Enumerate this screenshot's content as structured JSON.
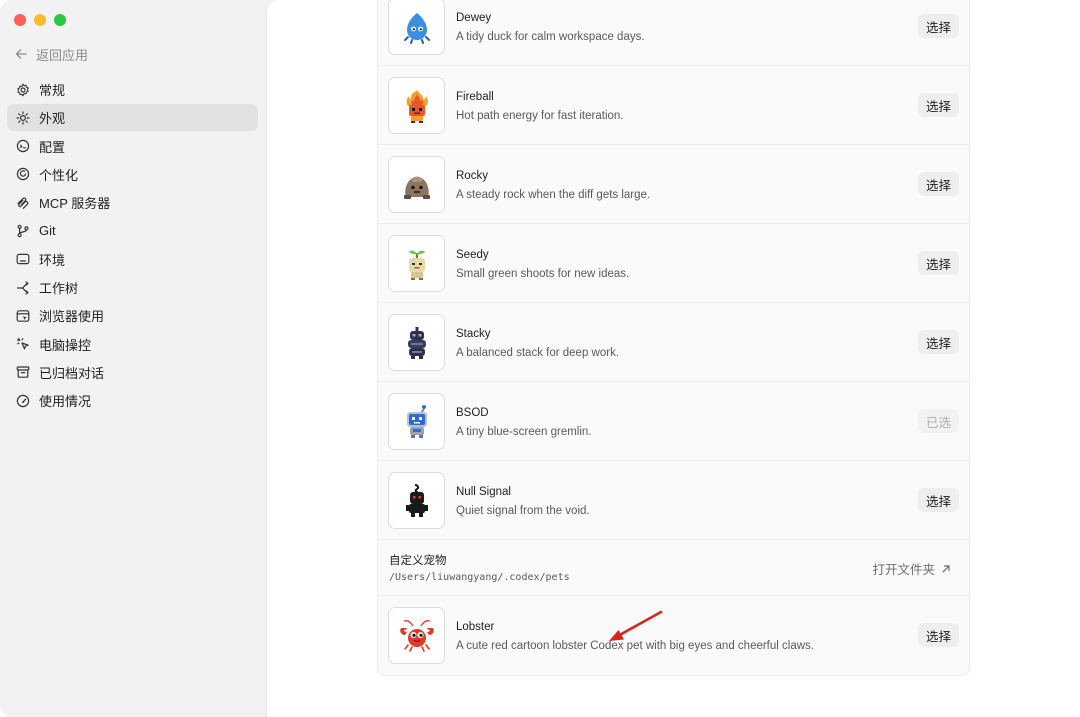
{
  "back_label": "返回应用",
  "nav": [
    {
      "label": "常规",
      "icon": "gear-icon"
    },
    {
      "label": "外观",
      "icon": "sun-icon",
      "active": true
    },
    {
      "label": "配置",
      "icon": "config-icon"
    },
    {
      "label": "个性化",
      "icon": "personalize-icon"
    },
    {
      "label": "MCP 服务器",
      "icon": "mcp-icon"
    },
    {
      "label": "Git",
      "icon": "git-branch-icon"
    },
    {
      "label": "环境",
      "icon": "terminal-icon"
    },
    {
      "label": "工作树",
      "icon": "worktree-icon"
    },
    {
      "label": "浏览器使用",
      "icon": "browser-icon"
    },
    {
      "label": "电脑操控",
      "icon": "cursor-sparkle-icon"
    },
    {
      "label": "已归档对话",
      "icon": "archive-icon"
    },
    {
      "label": "使用情况",
      "icon": "gauge-icon"
    }
  ],
  "pets": [
    {
      "name": "Dewey",
      "desc": "A tidy duck for calm workspace days.",
      "button": "选择",
      "icon": "blue-duck-icon",
      "color": "#3a8fe0"
    },
    {
      "name": "Fireball",
      "desc": "Hot path energy for fast iteration.",
      "button": "选择",
      "icon": "fireball-icon",
      "color": "#e8582a"
    },
    {
      "name": "Rocky",
      "desc": "A steady rock when the diff gets large.",
      "button": "选择",
      "icon": "rock-icon",
      "color": "#8a7560"
    },
    {
      "name": "Seedy",
      "desc": "Small green shoots for new ideas.",
      "button": "选择",
      "icon": "seedling-icon",
      "color": "#7bbf4a"
    },
    {
      "name": "Stacky",
      "desc": "A balanced stack for deep work.",
      "button": "选择",
      "icon": "stack-icon",
      "color": "#2e3148"
    },
    {
      "name": "BSOD",
      "desc": "A tiny blue-screen gremlin.",
      "button": "已选",
      "icon": "bsod-robot-icon",
      "color": "#2a6cd8",
      "selected": true
    },
    {
      "name": "Null Signal",
      "desc": "Quiet signal from the void.",
      "button": "选择",
      "icon": "null-signal-icon",
      "color": "#1a1a1a"
    }
  ],
  "custom": {
    "title": "自定义宠物",
    "path": "/Users/liuwangyang/.codex/pets",
    "open_label": "打开文件夹"
  },
  "custom_pet": {
    "name": "Lobster",
    "desc": "A cute red cartoon lobster Codex pet with big eyes and cheerful claws.",
    "button": "选择",
    "icon": "lobster-icon",
    "color": "#e03a2a"
  },
  "colors": {
    "arrow": "#d9241c",
    "active_bg": "#e2e2e2"
  }
}
